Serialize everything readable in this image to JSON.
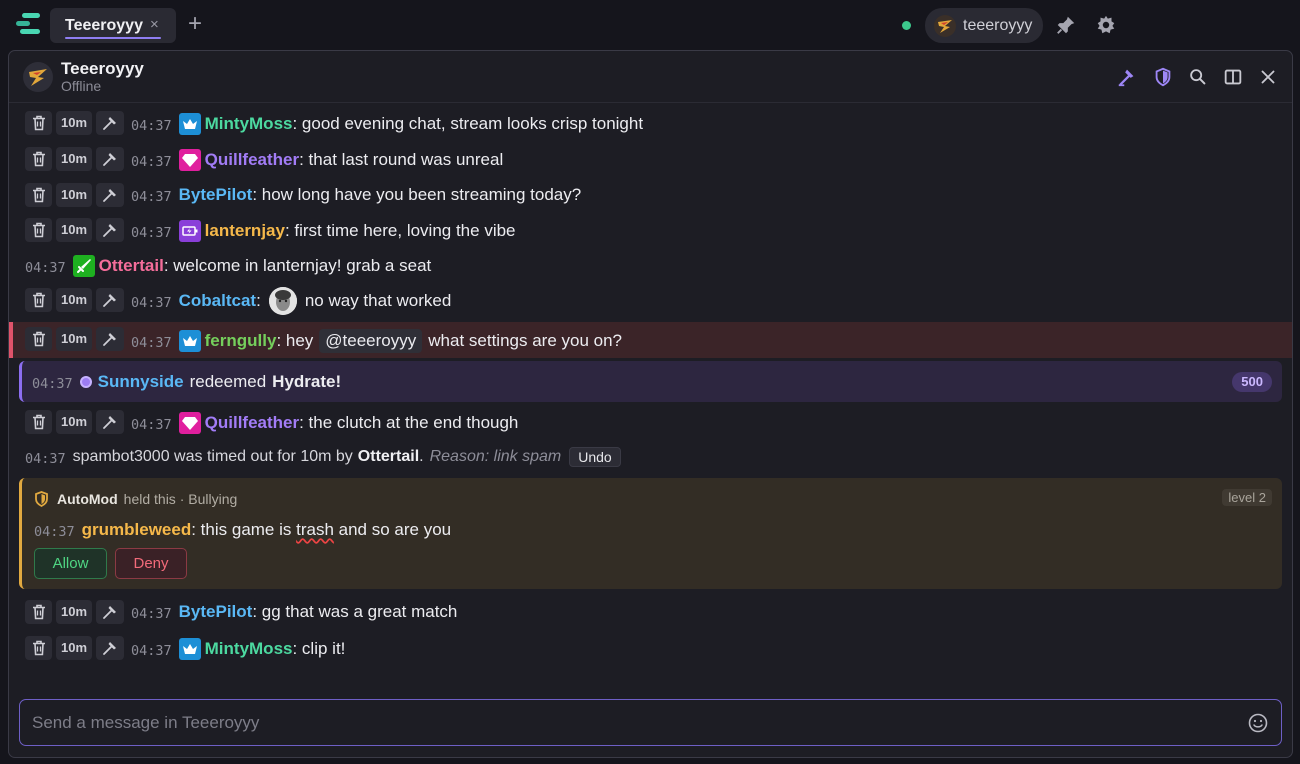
{
  "tabs": [
    {
      "label": "Teeeroyyy",
      "close": "×"
    }
  ],
  "new_tab": "+",
  "account": {
    "name": "teeeroyyy"
  },
  "channel": {
    "name": "Teeeroyyy",
    "status": "Offline"
  },
  "mod_actions": {
    "timeout": "10m"
  },
  "messages": [
    {
      "time": "04:37",
      "user": "MintyMoss",
      "user_color": "#4cd9a0",
      "badge": "crown",
      "text": ": good evening chat, stream looks crisp tonight"
    },
    {
      "time": "04:37",
      "user": "Quillfeather",
      "user_color": "#a27cf6",
      "badge": "gem",
      "text": ": that last round was unreal"
    },
    {
      "time": "04:37",
      "user": "BytePilot",
      "user_color": "#5ab8f5",
      "badge": "",
      "text": ": how long have you been streaming today?"
    },
    {
      "time": "04:37",
      "user": "lanternjay",
      "user_color": "#f5b84a",
      "badge": "bolt",
      "text": ": first time here, loving the vibe"
    },
    {
      "time": "04:37",
      "user": "Ottertail",
      "user_color": "#f46d9a",
      "badge": "sword",
      "text": ": welcome in lanternjay! grab a seat"
    },
    {
      "time": "04:37",
      "user": "Cobaltcat",
      "user_color": "#5ab8f5",
      "badge": "",
      "text_before": ":",
      "text": "no way that worked",
      "emote": "face-emote"
    },
    {
      "time": "04:37",
      "user": "ferngully",
      "user_color": "#75cf5c",
      "badge": "crown",
      "text_before": ": hey",
      "mention": "@teeeroyyy",
      "text": "what settings are you on?"
    },
    {
      "time": "04:37",
      "user": "Quillfeather",
      "user_color": "#a27cf6",
      "badge": "gem",
      "text": ": the clutch at the end though"
    },
    {
      "time": "04:37",
      "user": "BytePilot",
      "user_color": "#5ab8f5",
      "badge": "",
      "text": ": gg that was a great match"
    },
    {
      "time": "04:37",
      "user": "MintyMoss",
      "user_color": "#4cd9a0",
      "badge": "crown",
      "text": ": clip it!"
    }
  ],
  "redemption": {
    "time": "04:37",
    "user": "Sunnyside",
    "user_color": "#5ab8f5",
    "action": "redeemed",
    "reward": "Hydrate!",
    "cost": "500"
  },
  "timeout_notice": {
    "time": "04:37",
    "text": "spambot3000 was timed out for 10m by",
    "by": "Ottertail",
    "reason": "Reason: link spam",
    "undo": "Undo"
  },
  "automod": {
    "title": "AutoMod",
    "reason": "held this · Bullying",
    "level": "level 2",
    "time": "04:37",
    "user": "grumbleweed",
    "user_color": "#f5b84a",
    "text_a": ": this game is ",
    "flagged": "trash",
    "text_b": " and so are you",
    "allow": "Allow",
    "deny": "Deny"
  },
  "composer": {
    "placeholder": "Send a message in Teeeroyyy"
  },
  "colors": {
    "accent": "#8f7ef3",
    "mention": "#e0536a",
    "automod": "#e1a940",
    "live": "#3cc88c"
  }
}
